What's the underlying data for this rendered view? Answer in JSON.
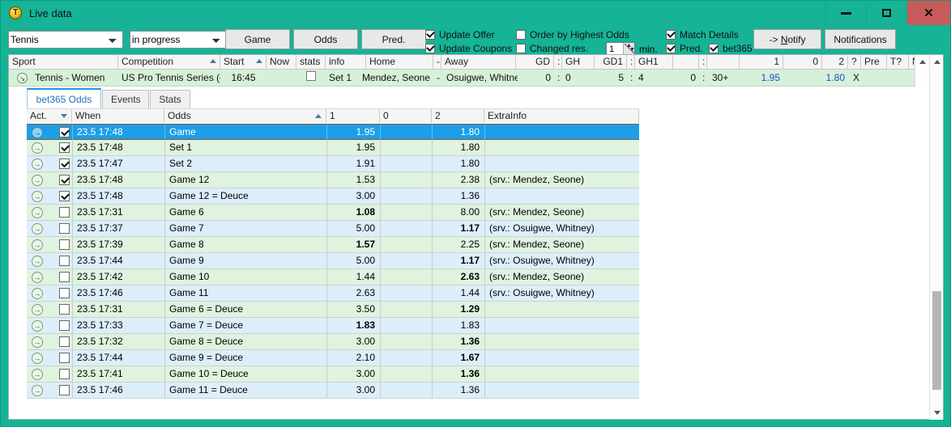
{
  "window": {
    "title": "Live data",
    "app_icon": "coin-icon",
    "minimize": "–",
    "maximize": "□",
    "close": "✕",
    "accent_color": "#16b396",
    "close_color": "#c75b5b"
  },
  "toolbar": {
    "sport_select": {
      "value": "Tennis",
      "options": [
        "Tennis"
      ]
    },
    "state_select": {
      "value": "in progress",
      "options": [
        "in progress"
      ]
    },
    "buttons": {
      "game": "Game",
      "odds": "Odds",
      "pred": "Pred.",
      "notify": "-> Notify",
      "notify_prefix": "-> ",
      "notify_n": "N",
      "notify_rest": "otify",
      "notifications": "Notifications"
    },
    "checkboxes": {
      "update_offer": {
        "label": "Update Offer",
        "checked": true
      },
      "update_coupons": {
        "label": "Update Coupons",
        "checked": true
      },
      "order_by_odds": {
        "label": "Order by Highest Odds",
        "checked": false
      },
      "changed_res": {
        "label": "Changed res.",
        "checked": false
      },
      "match_details": {
        "label": "Match Details",
        "checked": true
      },
      "pred": {
        "label": "Pred.",
        "checked": true
      },
      "bet365": {
        "label": "bet365",
        "checked": true
      }
    },
    "spinner": {
      "value": "1",
      "unit": "min."
    }
  },
  "top_grid": {
    "columns": [
      {
        "label": "Sport",
        "align": "left",
        "sort": ""
      },
      {
        "label": "Competition",
        "align": "left",
        "sort": "asc"
      },
      {
        "label": "Start",
        "align": "left",
        "sort": "asc"
      },
      {
        "label": "Now",
        "align": "left",
        "sort": ""
      },
      {
        "label": "stats",
        "align": "left",
        "sort": ""
      },
      {
        "label": "info",
        "align": "left",
        "sort": ""
      },
      {
        "label": "Home",
        "align": "left",
        "sort": ""
      },
      {
        "label": "-",
        "align": "left",
        "sort": ""
      },
      {
        "label": "Away",
        "align": "left",
        "sort": ""
      },
      {
        "label": "GD",
        "align": "right",
        "sort": ""
      },
      {
        "label": ":",
        "align": "left",
        "sort": ""
      },
      {
        "label": "GH",
        "align": "left",
        "sort": ""
      },
      {
        "label": "GD1",
        "align": "right",
        "sort": ""
      },
      {
        "label": ":",
        "align": "left",
        "sort": ""
      },
      {
        "label": "GH1",
        "align": "left",
        "sort": ""
      },
      {
        "label": "",
        "align": "left",
        "sort": ""
      },
      {
        "label": ":",
        "align": "left",
        "sort": ""
      },
      {
        "label": "",
        "align": "left",
        "sort": ""
      },
      {
        "label": "1",
        "align": "right",
        "sort": ""
      },
      {
        "label": "0",
        "align": "right",
        "sort": ""
      },
      {
        "label": "2",
        "align": "right",
        "sort": ""
      },
      {
        "label": "?",
        "align": "left",
        "sort": ""
      },
      {
        "label": "Pre",
        "align": "left",
        "sort": ""
      },
      {
        "label": "T?",
        "align": "left",
        "sort": ""
      },
      {
        "label": "Ntf.",
        "align": "left",
        "sort": ""
      }
    ],
    "row": {
      "sport": "Tennis - Women",
      "competition": "US Pro Tennis Series (exh.)",
      "start": "16:45",
      "now": "",
      "stats_checked": false,
      "info": "Set 1",
      "home": "Mendez, Seone",
      "dash": "-",
      "away": "Osuigwe, Whitney",
      "gd": "0",
      "gd_sep": ":",
      "gh": "0",
      "gd1": "5",
      "gd1_sep": ":",
      "gh1": "4",
      "pts_home": "0",
      "pts_sep": ":",
      "pts_away": "30+",
      "odds_1": "1.95",
      "odds_0": "",
      "odds_2": "1.80",
      "q": "X",
      "pre": "",
      "t": "",
      "ntf_checked": false
    }
  },
  "tabs": [
    {
      "label": "bet365 Odds",
      "active": true
    },
    {
      "label": "Events",
      "active": false
    },
    {
      "label": "Stats",
      "active": false
    }
  ],
  "odds_table": {
    "columns": [
      {
        "label": "Act.",
        "sort": "desc"
      },
      {
        "label": "",
        "sort": ""
      },
      {
        "label": "When",
        "sort": ""
      },
      {
        "label": "Odds",
        "sort": "asc"
      },
      {
        "label": "1",
        "sort": ""
      },
      {
        "label": "0",
        "sort": ""
      },
      {
        "label": "2",
        "sort": ""
      },
      {
        "label": "ExtraInfo",
        "sort": ""
      }
    ],
    "rows": [
      {
        "checked": true,
        "when": "23.5 17:48",
        "odds": "Game",
        "c1": "1.95",
        "c1b": false,
        "c0": "",
        "c2": "1.80",
        "c2b": false,
        "extra": "",
        "style": "sel"
      },
      {
        "checked": true,
        "when": "23.5 17:48",
        "odds": "Set 1",
        "c1": "1.95",
        "c1b": false,
        "c0": "",
        "c2": "1.80",
        "c2b": false,
        "extra": "",
        "style": "green"
      },
      {
        "checked": true,
        "when": "23.5 17:47",
        "odds": "Set 2",
        "c1": "1.91",
        "c1b": false,
        "c0": "",
        "c2": "1.80",
        "c2b": false,
        "extra": "",
        "style": "blue"
      },
      {
        "checked": true,
        "when": "23.5 17:48",
        "odds": "Game 12",
        "c1": "1.53",
        "c1b": false,
        "c0": "",
        "c2": "2.38",
        "c2b": false,
        "extra": "(srv.: Mendez, Seone)",
        "style": "green"
      },
      {
        "checked": true,
        "when": "23.5 17:48",
        "odds": "Game 12 = Deuce",
        "c1": "3.00",
        "c1b": false,
        "c0": "",
        "c2": "1.36",
        "c2b": false,
        "extra": "",
        "style": "blue"
      },
      {
        "checked": false,
        "when": "23.5 17:31",
        "odds": "Game 6",
        "c1": "1.08",
        "c1b": true,
        "c0": "",
        "c2": "8.00",
        "c2b": false,
        "extra": "(srv.: Mendez, Seone)",
        "style": "green"
      },
      {
        "checked": false,
        "when": "23.5 17:37",
        "odds": "Game 7",
        "c1": "5.00",
        "c1b": false,
        "c0": "",
        "c2": "1.17",
        "c2b": true,
        "extra": "(srv.: Osuigwe, Whitney)",
        "style": "blue"
      },
      {
        "checked": false,
        "when": "23.5 17:39",
        "odds": "Game 8",
        "c1": "1.57",
        "c1b": true,
        "c0": "",
        "c2": "2.25",
        "c2b": false,
        "extra": "(srv.: Mendez, Seone)",
        "style": "green"
      },
      {
        "checked": false,
        "when": "23.5 17:44",
        "odds": "Game 9",
        "c1": "5.00",
        "c1b": false,
        "c0": "",
        "c2": "1.17",
        "c2b": true,
        "extra": "(srv.: Osuigwe, Whitney)",
        "style": "blue"
      },
      {
        "checked": false,
        "when": "23.5 17:42",
        "odds": "Game 10",
        "c1": "1.44",
        "c1b": false,
        "c0": "",
        "c2": "2.63",
        "c2b": true,
        "extra": "(srv.: Mendez, Seone)",
        "style": "green"
      },
      {
        "checked": false,
        "when": "23.5 17:46",
        "odds": "Game 11",
        "c1": "2.63",
        "c1b": false,
        "c0": "",
        "c2": "1.44",
        "c2b": false,
        "extra": "(srv.: Osuigwe, Whitney)",
        "style": "blue"
      },
      {
        "checked": false,
        "when": "23.5 17:31",
        "odds": "Game 6 = Deuce",
        "c1": "3.50",
        "c1b": false,
        "c0": "",
        "c2": "1.29",
        "c2b": true,
        "extra": "",
        "style": "green"
      },
      {
        "checked": false,
        "when": "23.5 17:33",
        "odds": "Game 7 = Deuce",
        "c1": "1.83",
        "c1b": true,
        "c0": "",
        "c2": "1.83",
        "c2b": false,
        "extra": "",
        "style": "blue"
      },
      {
        "checked": false,
        "when": "23.5 17:32",
        "odds": "Game 8 = Deuce",
        "c1": "3.00",
        "c1b": false,
        "c0": "",
        "c2": "1.36",
        "c2b": true,
        "extra": "",
        "style": "green"
      },
      {
        "checked": false,
        "when": "23.5 17:44",
        "odds": "Game 9 = Deuce",
        "c1": "2.10",
        "c1b": false,
        "c0": "",
        "c2": "1.67",
        "c2b": true,
        "extra": "",
        "style": "blue"
      },
      {
        "checked": false,
        "when": "23.5 17:41",
        "odds": "Game 10 = Deuce",
        "c1": "3.00",
        "c1b": false,
        "c0": "",
        "c2": "1.36",
        "c2b": true,
        "extra": "",
        "style": "green"
      },
      {
        "checked": false,
        "when": "23.5 17:46",
        "odds": "Game 11 = Deuce",
        "c1": "3.00",
        "c1b": false,
        "c0": "",
        "c2": "1.36",
        "c2b": false,
        "extra": "",
        "style": "blue"
      }
    ]
  }
}
